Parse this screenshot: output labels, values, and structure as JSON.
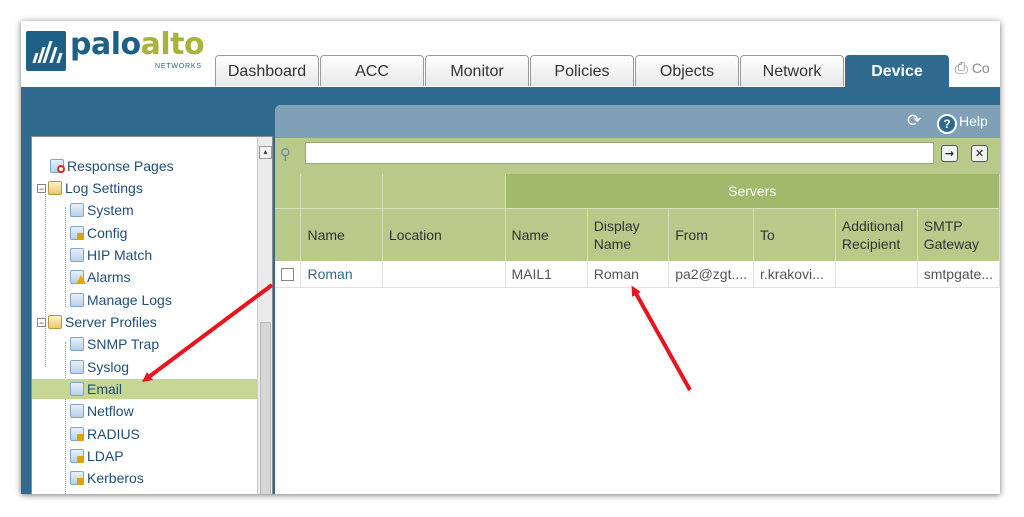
{
  "brand": {
    "name_part1": "palo",
    "name_part2": "alto",
    "sub": "NETWORKS"
  },
  "tabs": [
    {
      "label": "Dashboard"
    },
    {
      "label": "ACC"
    },
    {
      "label": "Monitor"
    },
    {
      "label": "Policies"
    },
    {
      "label": "Objects"
    },
    {
      "label": "Network"
    },
    {
      "label": "Device"
    }
  ],
  "active_tab": "Device",
  "commit": {
    "label": "Co"
  },
  "toolbar": {
    "help_label": "Help"
  },
  "filter": {
    "value": ""
  },
  "sidebar": {
    "items": [
      {
        "label": "Response Pages"
      },
      {
        "label": "Log Settings"
      },
      {
        "label": "System"
      },
      {
        "label": "Config"
      },
      {
        "label": "HIP Match"
      },
      {
        "label": "Alarms"
      },
      {
        "label": "Manage Logs"
      },
      {
        "label": "Server Profiles"
      },
      {
        "label": "SNMP Trap"
      },
      {
        "label": "Syslog"
      },
      {
        "label": "Email"
      },
      {
        "label": "Netflow"
      },
      {
        "label": "RADIUS"
      },
      {
        "label": "LDAP"
      },
      {
        "label": "Kerberos"
      }
    ],
    "selected": "Email"
  },
  "table": {
    "group_header": "Servers",
    "columns": [
      {
        "label": "Name"
      },
      {
        "label": "Location"
      },
      {
        "label": "Name"
      },
      {
        "label": "Display Name"
      },
      {
        "label": "From"
      },
      {
        "label": "To"
      },
      {
        "label": "Additional Recipient"
      },
      {
        "label": "SMTP Gateway"
      }
    ],
    "rows": [
      {
        "name": "Roman",
        "location": "",
        "server_name": "MAIL1",
        "display_name": "Roman",
        "from": "pa2@zgt....",
        "to": "r.krakovi...",
        "additional_recipient": "",
        "smtp_gateway": "smtpgate..."
      }
    ]
  },
  "colors": {
    "accent_blue": "#2e6b8f",
    "grid_green": "#b8c98a",
    "selection_green": "#c6d693",
    "annotation_red": "#e8141e"
  }
}
